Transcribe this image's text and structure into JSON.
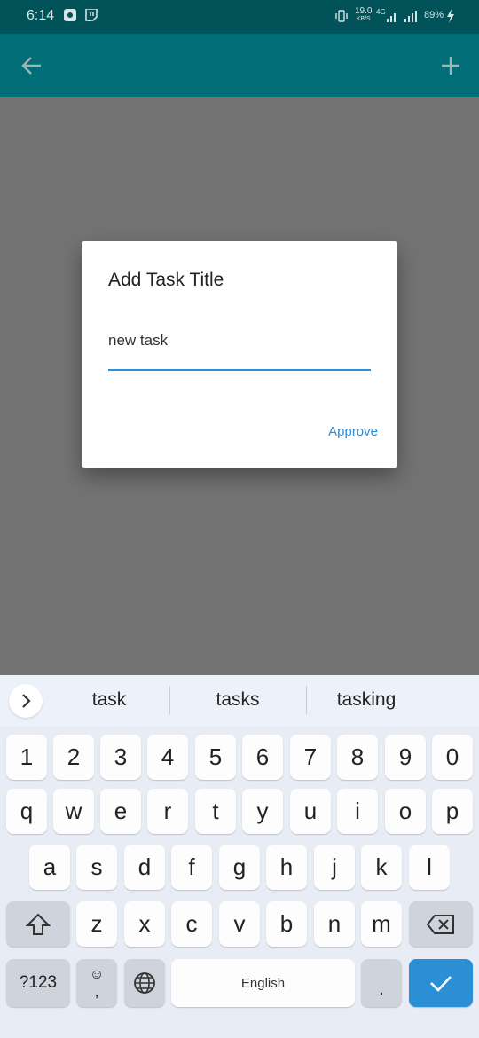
{
  "status_bar": {
    "time": "6:14",
    "speed_value": "19.0",
    "speed_unit": "KB/S",
    "network": "4G",
    "battery": "89%"
  },
  "app_bar": {
    "back_icon": "arrow-left-icon",
    "add_icon": "plus-icon"
  },
  "dialog": {
    "title": "Add Task Title",
    "input_value": "new task",
    "approve_label": "Approve"
  },
  "keyboard": {
    "suggestions": [
      "task",
      "tasks",
      "tasking"
    ],
    "number_row": [
      "1",
      "2",
      "3",
      "4",
      "5",
      "6",
      "7",
      "8",
      "9",
      "0"
    ],
    "row1": [
      "q",
      "w",
      "e",
      "r",
      "t",
      "y",
      "u",
      "i",
      "o",
      "p"
    ],
    "row2": [
      "a",
      "s",
      "d",
      "f",
      "g",
      "h",
      "j",
      "k",
      "l"
    ],
    "row3": [
      "z",
      "x",
      "c",
      "v",
      "b",
      "n",
      "m"
    ],
    "symbols_label": "?123",
    "emoji_label": "☺",
    "comma_label": ",",
    "space_label": "English",
    "period_label": ".",
    "colors": {
      "accent": "#2b8fd6",
      "toolbar": "#016d77"
    }
  }
}
